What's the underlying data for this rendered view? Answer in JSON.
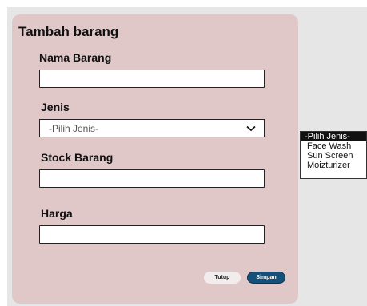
{
  "modal": {
    "title": "Tambah barang",
    "fields": {
      "nama_label": "Nama  Barang",
      "nama_value": "",
      "jenis_label": "Jenis",
      "jenis_selected": "-Pilih Jenis-",
      "stock_label": "Stock Barang",
      "stock_value": "",
      "harga_label": "Harga",
      "harga_value": ""
    },
    "buttons": {
      "tutup_label": "Tutup",
      "simpan_label": "Simpan"
    }
  },
  "dropdown": {
    "options": [
      "-Pilih Jenis-",
      "Face Wash",
      "Sun Screen",
      "Moizturizer"
    ],
    "highlighted_index": 0
  },
  "colors": {
    "modal_bg": "#e0c8c8",
    "primary_button": "#14507a",
    "backdrop": "#e6e6e6"
  },
  "icons": {
    "select_chevron": "chevron-down-icon"
  }
}
